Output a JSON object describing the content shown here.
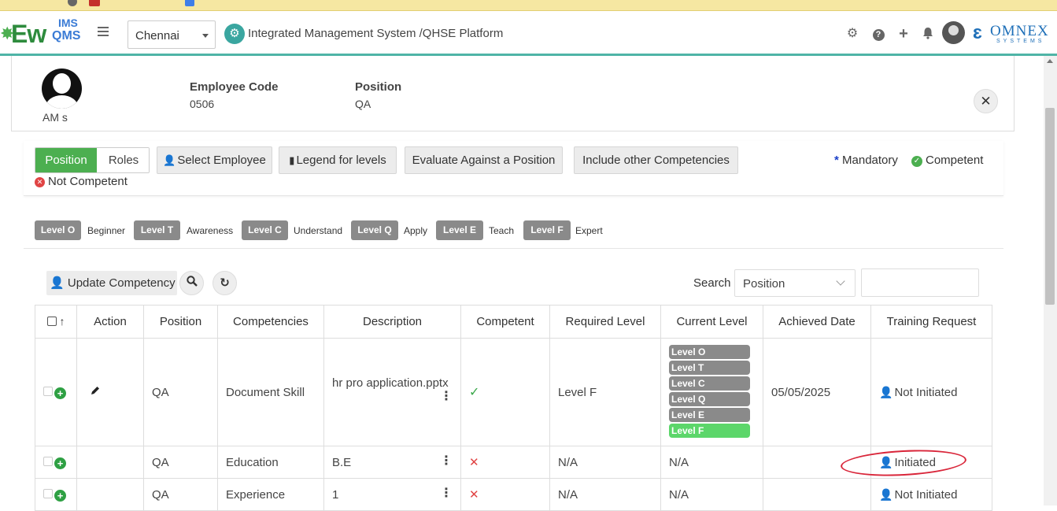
{
  "header": {
    "logo_ew": "Ew",
    "logo_ims": "IMS",
    "logo_qms": "QMS",
    "location": "Chennai",
    "platform_title": "Integrated Management System /QHSE Platform",
    "brand_name": "OMNEX",
    "brand_sub": "SYSTEMS"
  },
  "employee": {
    "name": "AM s",
    "code_label": "Employee Code",
    "code_value": "0506",
    "position_label": "Position",
    "position_value": "QA"
  },
  "toolbar": {
    "toggle_position": "Position",
    "toggle_roles": "Roles",
    "select_employee": "Select Employee",
    "legend_levels": "Legend for levels",
    "evaluate_position": "Evaluate Against a Position",
    "include_other": "Include other Competencies",
    "mandatory": "Mandatory",
    "competent": "Competent",
    "not_competent": "Not Competent"
  },
  "levels": [
    {
      "badge": "Level O",
      "name": "Beginner"
    },
    {
      "badge": "Level T",
      "name": "Awareness"
    },
    {
      "badge": "Level C",
      "name": "Understand"
    },
    {
      "badge": "Level Q",
      "name": "Apply"
    },
    {
      "badge": "Level E",
      "name": "Teach"
    },
    {
      "badge": "Level F",
      "name": "Expert"
    }
  ],
  "grid": {
    "update_competency": "Update Competency",
    "search_label": "Search",
    "search_field": "Position",
    "columns": [
      "Action",
      "Position",
      "Competencies",
      "Description",
      "Competent",
      "Required Level",
      "Current Level",
      "Achieved Date",
      "Training Request"
    ],
    "rows": [
      {
        "position": "QA",
        "competency": "Document Skill",
        "description": "hr pro application.pptx",
        "competent": true,
        "required": "Level F",
        "current_levels": [
          "Level O",
          "Level T",
          "Level C",
          "Level Q",
          "Level E",
          "Level F"
        ],
        "achieved": "05/05/2025",
        "training": "Not Initiated"
      },
      {
        "position": "QA",
        "competency": "Education",
        "description": "B.E",
        "competent": false,
        "required": "N/A",
        "current": "N/A",
        "achieved": "",
        "training": "Initiated"
      },
      {
        "position": "QA",
        "competency": "Experience",
        "description": "1",
        "competent": false,
        "required": "N/A",
        "current": "N/A",
        "achieved": "",
        "training": "Not Initiated"
      }
    ]
  },
  "colors": {
    "accent_green": "#4caf50",
    "teal_border": "#4fb4a6",
    "level_gray": "#8a8a8a",
    "level_active": "#5cd66a",
    "annotation_red": "#d9263a"
  }
}
